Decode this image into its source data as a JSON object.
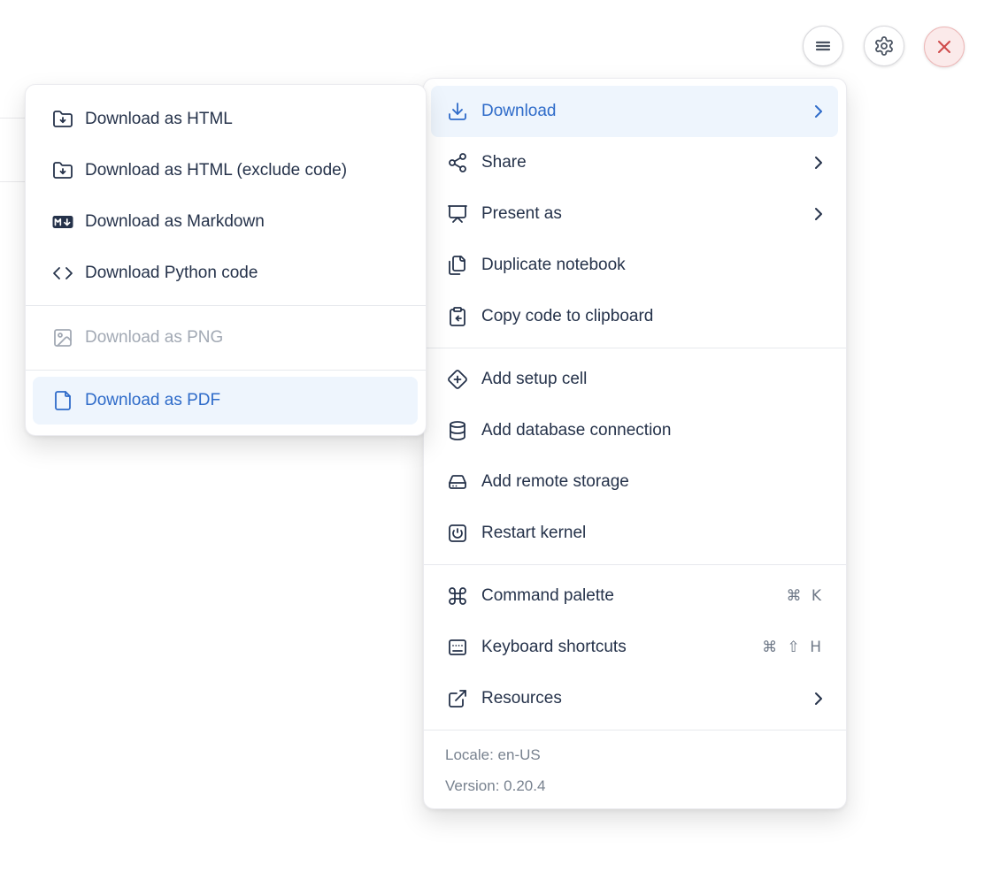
{
  "toolbar": {
    "buttons": [
      {
        "id": "notebook-menu",
        "icon": "hamburger-icon"
      },
      {
        "id": "settings",
        "icon": "gear-icon"
      },
      {
        "id": "close",
        "icon": "close-icon"
      }
    ]
  },
  "main_menu": {
    "items": [
      {
        "label": "Download",
        "icon": "download-icon",
        "has_submenu": true,
        "active": true
      },
      {
        "label": "Share",
        "icon": "share-icon",
        "has_submenu": true
      },
      {
        "label": "Present as",
        "icon": "presentation-icon",
        "has_submenu": true
      },
      {
        "label": "Duplicate notebook",
        "icon": "duplicate-icon"
      },
      {
        "label": "Copy code to clipboard",
        "icon": "clipboard-copy-icon"
      },
      {
        "label": "Add setup cell",
        "icon": "diamond-plus-icon"
      },
      {
        "label": "Add database connection",
        "icon": "database-icon"
      },
      {
        "label": "Add remote storage",
        "icon": "hard-drive-icon"
      },
      {
        "label": "Restart kernel",
        "icon": "power-icon"
      },
      {
        "label": "Command palette",
        "icon": "command-icon",
        "shortcut": "⌘ K"
      },
      {
        "label": "Keyboard shortcuts",
        "icon": "keyboard-icon",
        "shortcut": "⌘ ⇧ H"
      },
      {
        "label": "Resources",
        "icon": "external-link-icon",
        "has_submenu": true
      }
    ],
    "footer": {
      "locale": "Locale: en-US",
      "version": "Version: 0.20.4"
    }
  },
  "download_submenu": {
    "items": [
      {
        "label": "Download as HTML",
        "icon": "folder-down-icon"
      },
      {
        "label": "Download as HTML (exclude code)",
        "icon": "folder-down-icon"
      },
      {
        "label": "Download as Markdown",
        "icon": "markdown-icon"
      },
      {
        "label": "Download Python code",
        "icon": "code-icon"
      },
      {
        "label": "Download as PNG",
        "icon": "image-icon",
        "disabled": true
      },
      {
        "label": "Download as PDF",
        "icon": "file-icon",
        "active": true
      }
    ]
  },
  "colors": {
    "accent": "#2e6bc9",
    "accent_bg": "#eef5fd",
    "text": "#25324a",
    "disabled_text": "#a2a9b4",
    "footer_text": "#78828f",
    "separator": "#e7e9ed",
    "danger": "#cf4a4a",
    "danger_bg": "#fbeaea",
    "danger_border": "#edb7b7"
  }
}
